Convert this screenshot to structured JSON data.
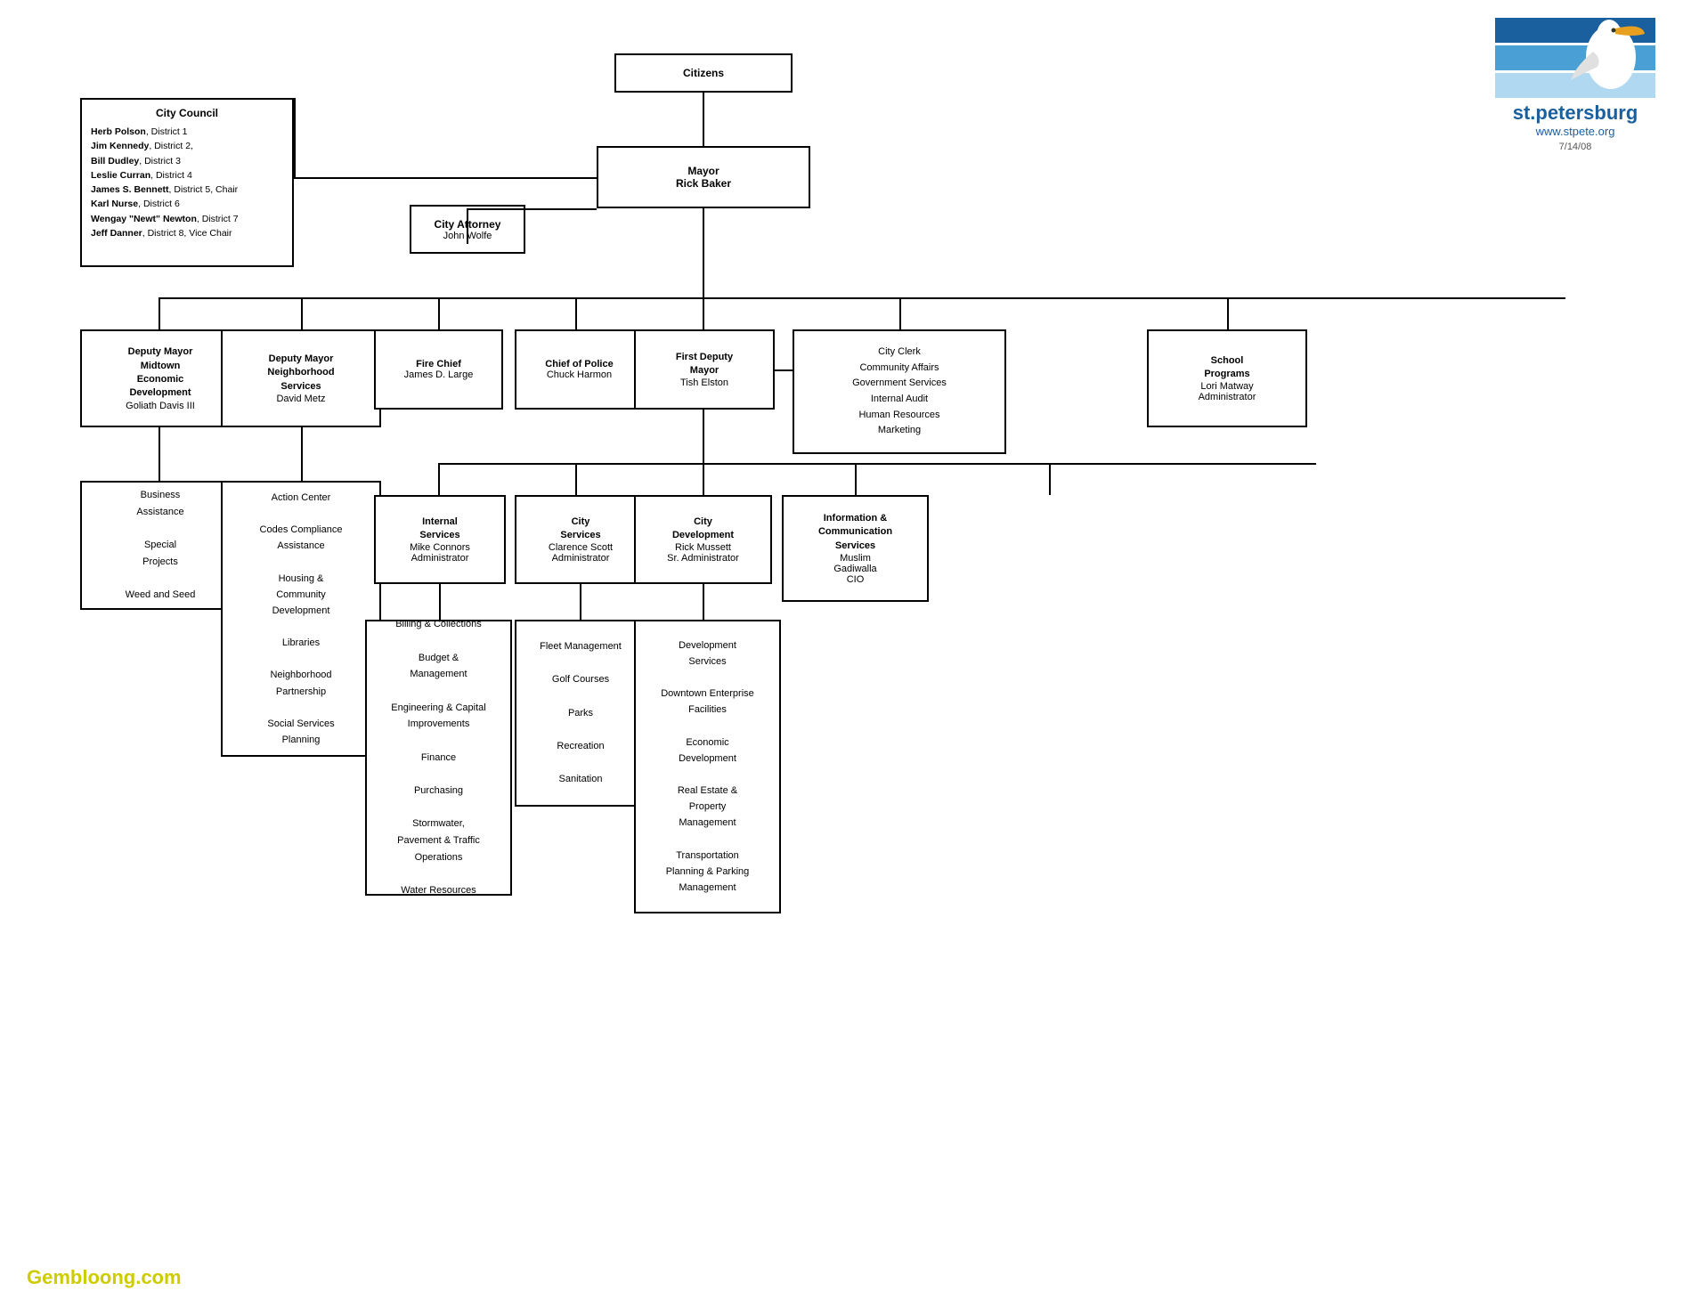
{
  "logo": {
    "name": "st.petersburg",
    "url": "www.stpete.org",
    "date": "7/14/08"
  },
  "watermark": "Gembloong.com",
  "nodes": {
    "citizens": "Citizens",
    "mayor_title": "Mayor",
    "mayor_name": "Rick Baker",
    "city_attorney_title": "City Attorney",
    "city_attorney_name": "John Wolfe",
    "city_council_title": "City Council",
    "city_council_members": [
      "Herb Polson, District 1",
      "Jim Kennedy, District 2,",
      "Bill Dudley, District 3",
      "Leslie Curran, District 4",
      "James S. Bennett, District 5, Chair",
      "Karl Nurse, District 6",
      "Wengay \"Newt\" Newton, District 7",
      "Jeff Danner, District 8, Vice Chair"
    ],
    "dep_mayor_midtown_title": "Deputy Mayor\nMidtown\nEconomic\nDevelopment",
    "dep_mayor_midtown_name": "Goliath Davis III",
    "dep_mayor_neighborhood_title": "Deputy Mayor\nNeighborhood\nServices",
    "dep_mayor_neighborhood_name": "David Metz",
    "fire_chief_title": "Fire Chief",
    "fire_chief_name": "James D. Large",
    "chief_police_title": "Chief of Police",
    "chief_police_name": "Chuck Harmon",
    "first_dep_mayor_title": "First Deputy\nMayor",
    "first_dep_mayor_name": "Tish Elston",
    "city_clerk_list": "City Clerk\nCommunity Affairs\nGovernment Services\nInternal Audit\nHuman Resources\nMarketing",
    "school_programs_title": "School\nPrograms",
    "school_programs_name": "Lori Matway\nAdministrator",
    "business_assistance_list": "Business\nAssistance\n\nSpecial\nProjects\n\nWeed and Seed",
    "action_center_list": "Action Center\n\nCodes Compliance\nAssistance\n\nHousing &\nCommunity\nDevelopment\n\nLibraries\n\nNeighborhood\nPartnership\n\nSocial Services\nPlanning",
    "internal_services_title": "Internal\nServices",
    "internal_services_name": "Mike Connors\nAdministrator",
    "city_services_title": "City\nServices",
    "city_services_name": "Clarence Scott\nAdministrator",
    "city_development_title": "City\nDevelopment",
    "city_development_name": "Rick Mussett\nSr. Administrator",
    "info_comm_title": "Information &\nCommunication\nServices",
    "info_comm_name": "Muslim\nGadiwalla\nCIO",
    "internal_services_list": "Billing & Collections\n\nBudget &\nManagement\n\nEngineering & Capital\nImprovements\n\nFinance\n\nPurchasing\n\nStormwater,\nPavement & Traffic\nOperations\n\nWater Resources",
    "city_services_list": "Fleet Management\n\nGolf Courses\n\nParks\n\nRecreation\n\nSanitation",
    "city_development_list": "Development\nServices\n\nDowntown Enterprise\nFacilities\n\nEconomic\nDevelopment\n\nReal Estate &\nProperty\nManagement\n\nTransportation\nPlanning & Parking\nManagement"
  }
}
